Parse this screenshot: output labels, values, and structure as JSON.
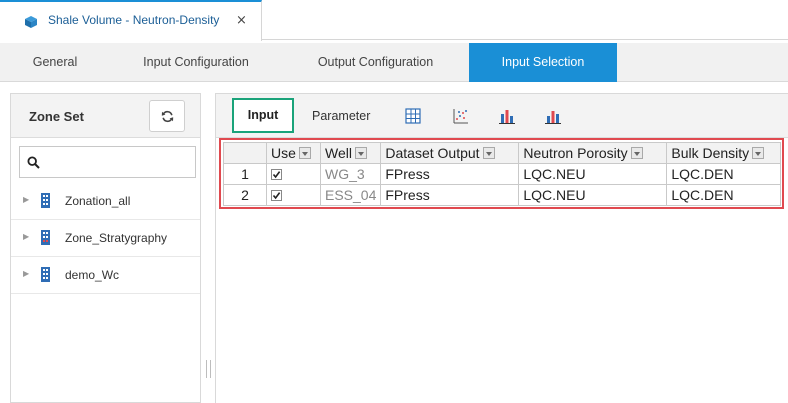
{
  "document_tab": {
    "title": "Shale Volume - Neutron-Density",
    "close": "×",
    "icon": "cube-icon"
  },
  "config_tabs": [
    {
      "label": "General"
    },
    {
      "label": "Input Configuration"
    },
    {
      "label": "Output Configuration"
    },
    {
      "label": "Input Selection",
      "active": true
    }
  ],
  "left_panel": {
    "title": "Zone Set",
    "refresh_icon": "refresh-icon",
    "search": {
      "placeholder": "",
      "value": ""
    },
    "tree_items": [
      {
        "label": "Zonation_all",
        "icon": "zone-building-icon"
      },
      {
        "label": "Zone_Stratygraphy",
        "icon": "zone-building-icon"
      },
      {
        "label": "demo_Wc",
        "icon": "zone-building-icon"
      }
    ]
  },
  "toolbar": {
    "input_label": "Input",
    "parameter_label": "Parameter",
    "icons": [
      "grid-select-icon",
      "scatter-plot-icon",
      "bar-chart-icon",
      "bar-chart-icon-2"
    ]
  },
  "grid": {
    "columns": [
      "Use",
      "Well",
      "Dataset Output",
      "Neutron Porosity",
      "Bulk Density"
    ],
    "rows": [
      {
        "num": "1",
        "use": true,
        "well": "WG_3",
        "dataset": "FPress",
        "neutron": "LQC.NEU",
        "density": "LQC.DEN"
      },
      {
        "num": "2",
        "use": true,
        "well": "ESS_04",
        "dataset": "FPress",
        "neutron": "LQC.NEU",
        "density": "LQC.DEN"
      }
    ]
  },
  "colors": {
    "accent": "#1a8fd6",
    "input_highlight": "#1aa37a",
    "grid_highlight": "#e0494f"
  }
}
